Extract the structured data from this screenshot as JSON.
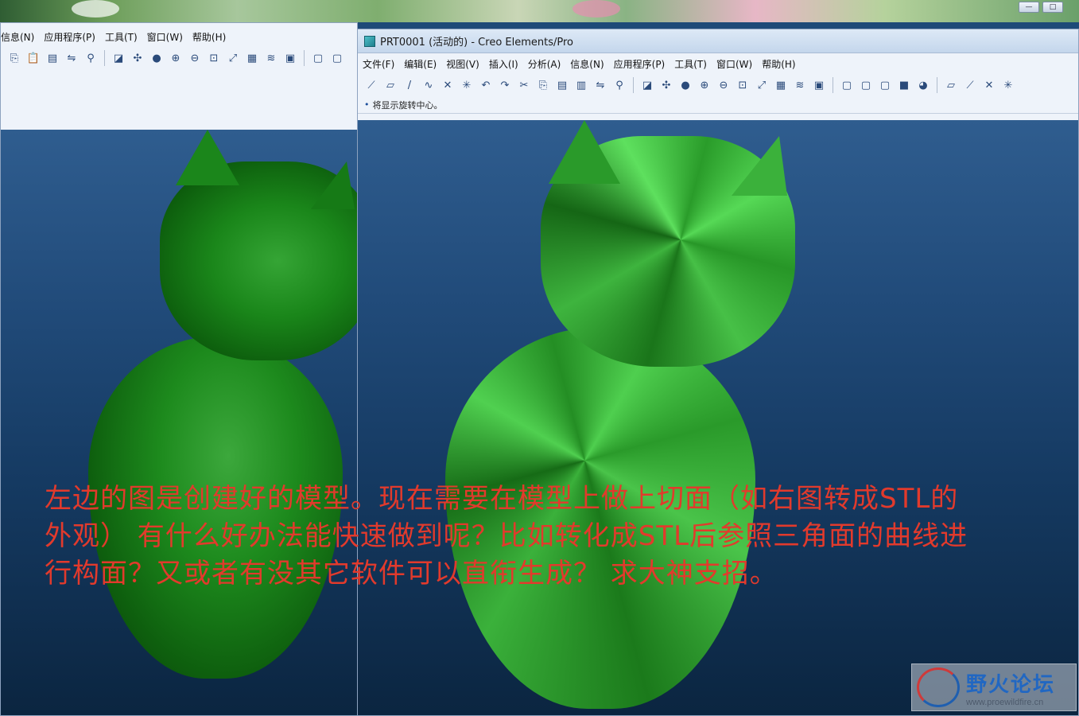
{
  "left_window": {
    "menu": [
      "信息(N)",
      "应用程序(P)",
      "工具(T)",
      "窗口(W)",
      "帮助(H)"
    ]
  },
  "right_window": {
    "title": "PRT0001 (活动的) - Creo Elements/Pro",
    "menu": [
      "文件(F)",
      "编辑(E)",
      "视图(V)",
      "插入(I)",
      "分析(A)",
      "信息(N)",
      "应用程序(P)",
      "工具(T)",
      "窗口(W)",
      "帮助(H)"
    ],
    "status_message": "将显示旋转中心。"
  },
  "caption": "左边的图是创建好的模型。现在需要在模型上做上切面（如右图转成STL的外观） 有什么好办法能快速做到呢？比如转化成STL后参照三角面的曲线进行构面？又或者有没其它软件可以直衔生成？ 求大神支招。",
  "watermark": {
    "title": "野火论坛",
    "url": "www.proewildfire.cn"
  },
  "colors": {
    "caption": "#e23a2c",
    "viewport_top": "#2f5d8f",
    "viewport_bottom": "#0b2540",
    "model_green": "#1d8a1d"
  }
}
